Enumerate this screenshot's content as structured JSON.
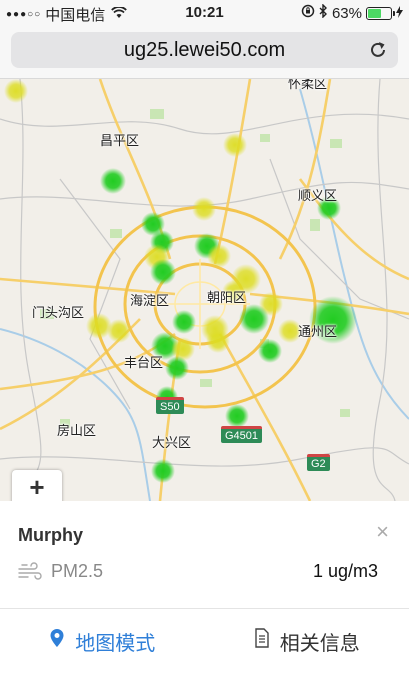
{
  "status_bar": {
    "signal": "●●●○○",
    "carrier": "中国电信",
    "time": "10:21",
    "battery_percent": "63%",
    "battery_level": 0.63,
    "battery_color": "#4cd964"
  },
  "browser": {
    "url": "ug25.lewei50.com"
  },
  "map": {
    "places": [
      {
        "id": "changping",
        "text": "昌平区"
      },
      {
        "id": "shunyi",
        "text": "顺义区"
      },
      {
        "id": "mentougou",
        "text": "门头沟区"
      },
      {
        "id": "haidian",
        "text": "海淀区"
      },
      {
        "id": "chaoyang",
        "text": "朝阳区"
      },
      {
        "id": "tongzhou",
        "text": "通州区"
      },
      {
        "id": "fengtai",
        "text": "丰台区"
      },
      {
        "id": "fangshan",
        "text": "房山区"
      },
      {
        "id": "daxing",
        "text": "大兴区"
      },
      {
        "id": "huairou",
        "text": "怀柔区"
      }
    ],
    "highways": [
      {
        "id": "s50",
        "text": "S50"
      },
      {
        "id": "g4501",
        "text": "G4501"
      },
      {
        "id": "g2",
        "text": "G2"
      }
    ],
    "zoom_in_label": "+"
  },
  "info_panel": {
    "station_name": "Murphy",
    "close_label": "×",
    "metric_name": "PM2.5",
    "metric_value": "1 ug/m3"
  },
  "tabs": [
    {
      "label": "地图模式",
      "icon": "map-pin-icon",
      "active": true
    },
    {
      "label": "相关信息",
      "icon": "document-icon",
      "active": false
    }
  ],
  "colors": {
    "accent": "#2f7fd8",
    "good_marker": "#22cc22",
    "moderate_marker": "#dddd22"
  }
}
